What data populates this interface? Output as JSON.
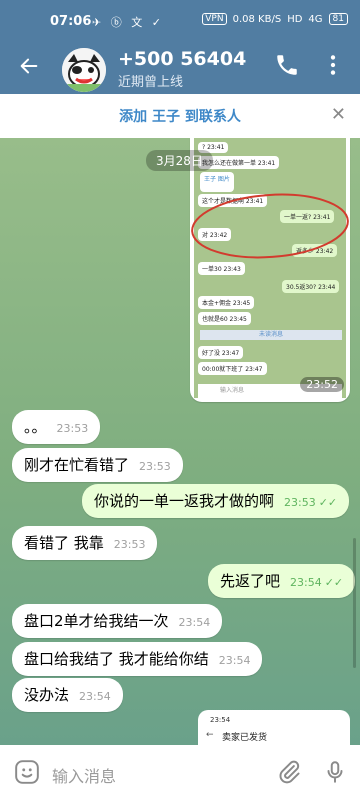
{
  "status_bar": {
    "time": "07:06",
    "icons": "✈ ⓑ 文 ✓",
    "vpn": "VPN",
    "speed": "0.08 KB/S",
    "hd": "HD",
    "signal": "4G",
    "battery": "81"
  },
  "header": {
    "title": "+500 56404",
    "subtitle": "近期曾上线"
  },
  "add_contact_bar": {
    "label": "添加 王子 到联系人"
  },
  "date_chip": "3月28日",
  "screenshot_message": {
    "time": "23:52",
    "mini_messages": [
      {
        "text": "?  23:41",
        "dir": "in"
      },
      {
        "text": "我怎么还在做第一单  23:41",
        "dir": "in"
      },
      {
        "text": "王子 图片",
        "dir": "in"
      },
      {
        "text": "这个才是数据啊  23:41",
        "dir": "in"
      },
      {
        "text": "一单一返?  23:41",
        "dir": "out"
      },
      {
        "text": "对  23:42",
        "dir": "in"
      },
      {
        "text": "返多少  23:42",
        "dir": "out"
      },
      {
        "text": "一单30  23:43",
        "dir": "in"
      },
      {
        "text": "30.5返30?  23:44",
        "dir": "out"
      },
      {
        "text": "本金+佣金  23:45",
        "dir": "in"
      },
      {
        "text": "也就是60  23:45",
        "dir": "in"
      },
      {
        "text": "好了没  23:47",
        "dir": "in"
      },
      {
        "text": "00:00就下班了  23:47",
        "dir": "in"
      }
    ],
    "mini_date": "3月28日",
    "mini_unread": "未读消息",
    "mini_input": "输入消息"
  },
  "messages": [
    {
      "text": "。。",
      "time": "23:53",
      "dir": "in"
    },
    {
      "text": "刚才在忙看错了",
      "time": "23:53",
      "dir": "in"
    },
    {
      "text": "你说的一单一返我才做的啊",
      "time": "23:53",
      "dir": "out"
    },
    {
      "text": "看错了 我靠",
      "time": "23:53",
      "dir": "in"
    },
    {
      "text": "先返了吧",
      "time": "23:54",
      "dir": "out"
    },
    {
      "text": "盘口2单才给我结一次",
      "time": "23:54",
      "dir": "in"
    },
    {
      "text": "盘口给我结了 我才能给你结",
      "time": "23:54",
      "dir": "in"
    },
    {
      "text": "没办法",
      "time": "23:54",
      "dir": "in"
    }
  ],
  "screenshot2": {
    "status": "23:54",
    "label": "卖家已发货"
  },
  "input_bar": {
    "placeholder": "输入消息"
  },
  "checks": "✓✓",
  "colors": {
    "header": "#517da2",
    "accent": "#3e88c8",
    "out_bubble": "#eaffd7",
    "check": "#5fb45f"
  }
}
